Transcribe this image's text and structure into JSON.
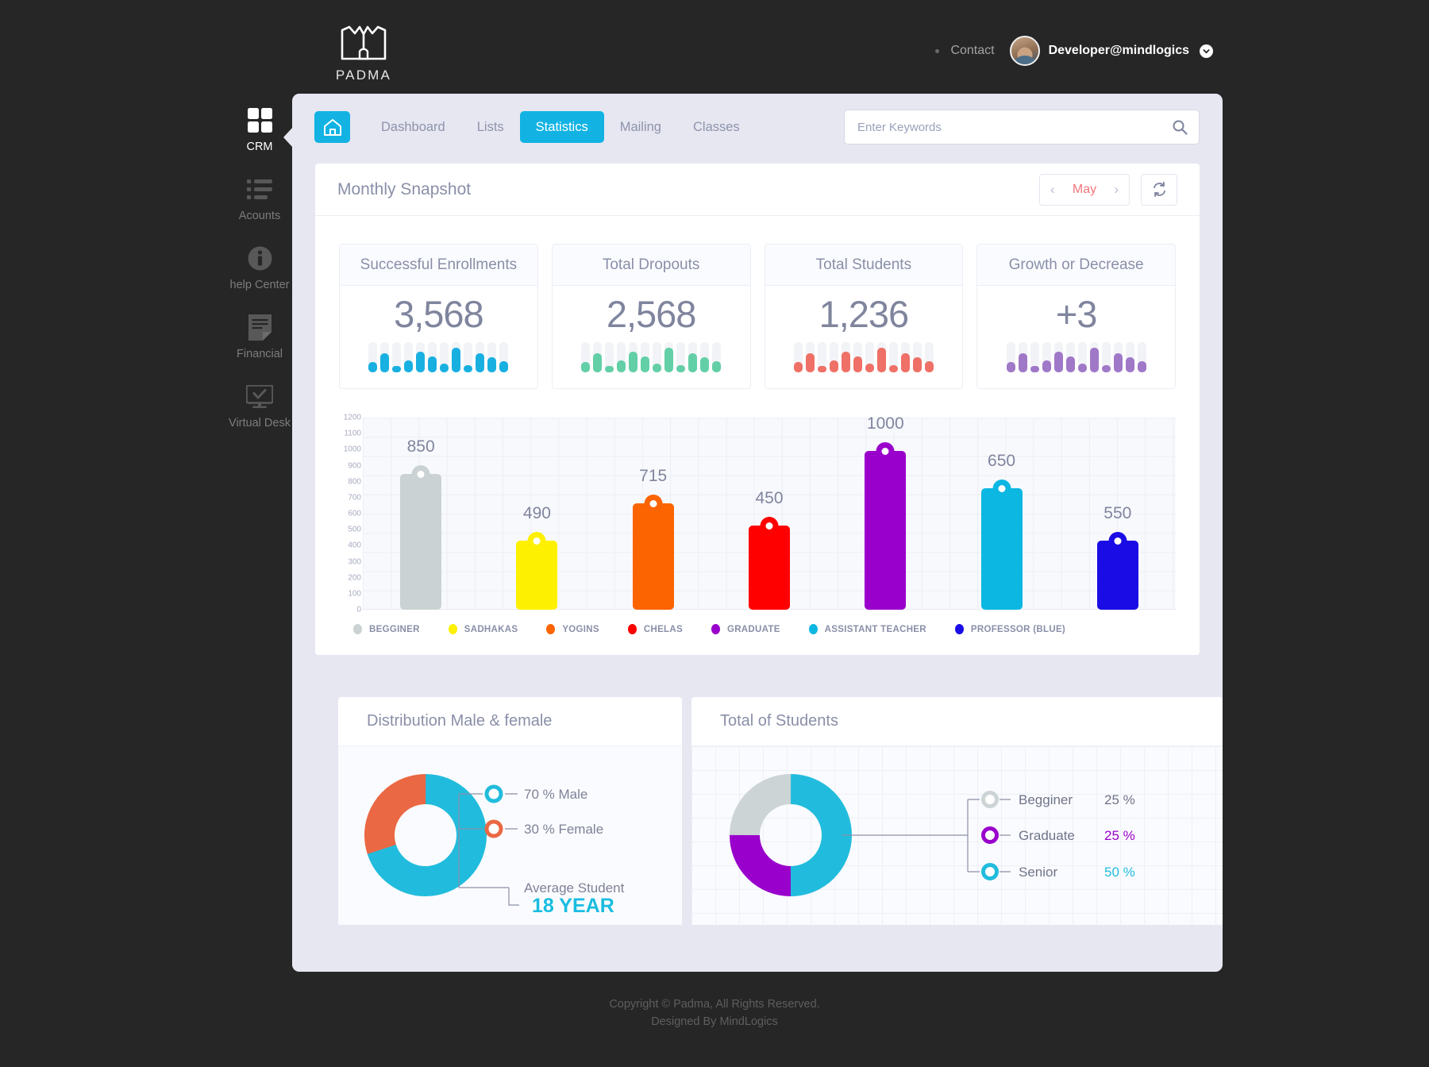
{
  "brand": {
    "name": "PADMA",
    "logo_icon": "padma-lotus-book-logo"
  },
  "topbar": {
    "contact_label": "Contact",
    "user_name": "Developer@mindlogics",
    "avatar_icon": "user-avatar",
    "chevron_icon": "chevron-down-icon"
  },
  "sidebar": {
    "items": [
      {
        "label": "CRM",
        "icon": "grid-squares-icon",
        "active": true
      },
      {
        "label": "Acounts",
        "icon": "list-bullets-icon",
        "active": false
      },
      {
        "label": "help Center",
        "icon": "info-circle-icon",
        "active": false
      },
      {
        "label": "Financial",
        "icon": "document-icon",
        "active": false
      },
      {
        "label": "Virtual Desk",
        "icon": "monitor-check-icon",
        "active": false
      }
    ]
  },
  "navbar": {
    "home_icon": "home-icon",
    "tabs": [
      {
        "label": "Dashboard",
        "active": false
      },
      {
        "label": "Lists",
        "active": false
      },
      {
        "label": "Statistics",
        "active": true
      },
      {
        "label": "Mailing",
        "active": false
      },
      {
        "label": "Classes",
        "active": false
      }
    ],
    "search": {
      "placeholder": "Enter Keywords",
      "value": "",
      "icon": "search-icon"
    }
  },
  "snapshot": {
    "title": "Monthly Snapshot",
    "month": "May",
    "prev_icon": "chevron-left-icon",
    "next_icon": "chevron-right-icon",
    "refresh_icon": "refresh-icon"
  },
  "kpis": [
    {
      "title": "Successful Enrollments",
      "value": "3,568",
      "color": "#18b0e0",
      "spark": [
        34,
        63,
        21,
        41,
        68,
        54,
        30,
        81,
        23,
        63,
        51,
        38
      ]
    },
    {
      "title": "Total Dropouts",
      "value": "2,568",
      "color": "#63cfa7",
      "spark": [
        34,
        63,
        21,
        41,
        68,
        54,
        30,
        81,
        23,
        63,
        51,
        38
      ]
    },
    {
      "title": "Total Students",
      "value": "1,236",
      "color": "#ef7066",
      "spark": [
        34,
        63,
        21,
        41,
        68,
        54,
        30,
        81,
        23,
        63,
        51,
        38
      ]
    },
    {
      "title": "Growth or Decrease",
      "value": "+3",
      "color": "#a078c8",
      "spark": [
        34,
        63,
        21,
        41,
        68,
        54,
        30,
        81,
        23,
        63,
        51,
        38
      ]
    }
  ],
  "chart_data": {
    "type": "bar",
    "title": "",
    "xlabel": "",
    "ylabel": "",
    "ylim": [
      0,
      1200
    ],
    "yticks": [
      1200,
      1100,
      1000,
      900,
      800,
      700,
      600,
      500,
      400,
      300,
      200,
      100,
      0
    ],
    "grid": true,
    "legend_position": "bottom",
    "categories": [
      "BEGGINER",
      "SADHAKAS",
      "YOGINS",
      "CHELAS",
      "GRADUATE",
      "ASSISTANT TEACHER",
      "PROFESSOR (BLUE)"
    ],
    "values": [
      850,
      490,
      715,
      450,
      1000,
      650,
      550
    ],
    "plotted_heights": [
      850,
      430,
      665,
      525,
      990,
      760,
      430
    ],
    "colors": [
      "#cbd2d3",
      "#fdf000",
      "#fb6400",
      "#fe0000",
      "#9a00cb",
      "#0cb7e2",
      "#1a0ce5"
    ],
    "bars": [
      {
        "name": "BEGGINER",
        "label": "850",
        "value": 850,
        "plot": 850,
        "color": "#cbd2d3"
      },
      {
        "name": "SADHAKAS",
        "label": "490",
        "value": 490,
        "plot": 430,
        "color": "#fdf000"
      },
      {
        "name": "YOGINS",
        "label": "715",
        "value": 715,
        "plot": 665,
        "color": "#fb6400"
      },
      {
        "name": "CHELAS",
        "label": "450",
        "value": 450,
        "plot": 525,
        "color": "#fe0000"
      },
      {
        "name": "GRADUATE",
        "label": "1000",
        "value": 1000,
        "plot": 990,
        "color": "#9a00cb"
      },
      {
        "name": "ASSISTANT TEACHER",
        "label": "650",
        "value": 650,
        "plot": 760,
        "color": "#0cb7e2"
      },
      {
        "name": "PROFESSOR (BLUE)",
        "label": "550",
        "value": 550,
        "plot": 430,
        "color": "#1a0ce5"
      }
    ]
  },
  "distribution": {
    "title": "Distribution Male & female",
    "chart": {
      "type": "pie",
      "title": "Distribution Male & female",
      "categories": [
        "Male",
        "Female"
      ],
      "values": [
        70,
        30
      ],
      "colors": [
        "#21bcdd",
        "#ea6843"
      ],
      "donut": true
    },
    "legend": [
      {
        "label": "70 % Male",
        "color": "#21bcdd"
      },
      {
        "label": "30 % Female",
        "color": "#ea6843"
      }
    ],
    "avg_label": "Average Student",
    "avg_value": "18 YEAR"
  },
  "total_students": {
    "title": "Total of Students",
    "chart": {
      "type": "pie",
      "title": "Total of Students",
      "categories": [
        "Begginer",
        "Graduate",
        "Senior"
      ],
      "values": [
        25,
        25,
        50
      ],
      "colors": [
        "#ccd4d6",
        "#9a00cb",
        "#21bcdd"
      ],
      "donut": true
    },
    "legend": [
      {
        "label": "Begginer",
        "pct": "25 %",
        "color": "#ccd4d6",
        "pct_color": "#6f7489"
      },
      {
        "label": "Graduate",
        "pct": "25 %",
        "color": "#9a00cb",
        "pct_color": "#9a00cb"
      },
      {
        "label": "Senior",
        "pct": "50 %",
        "color": "#21bcdd",
        "pct_color": "#21bcdd"
      }
    ]
  },
  "footer": {
    "line1": "Copyright © Padma, All Rights Reserved.",
    "line2": "Designed By MindLogics"
  }
}
